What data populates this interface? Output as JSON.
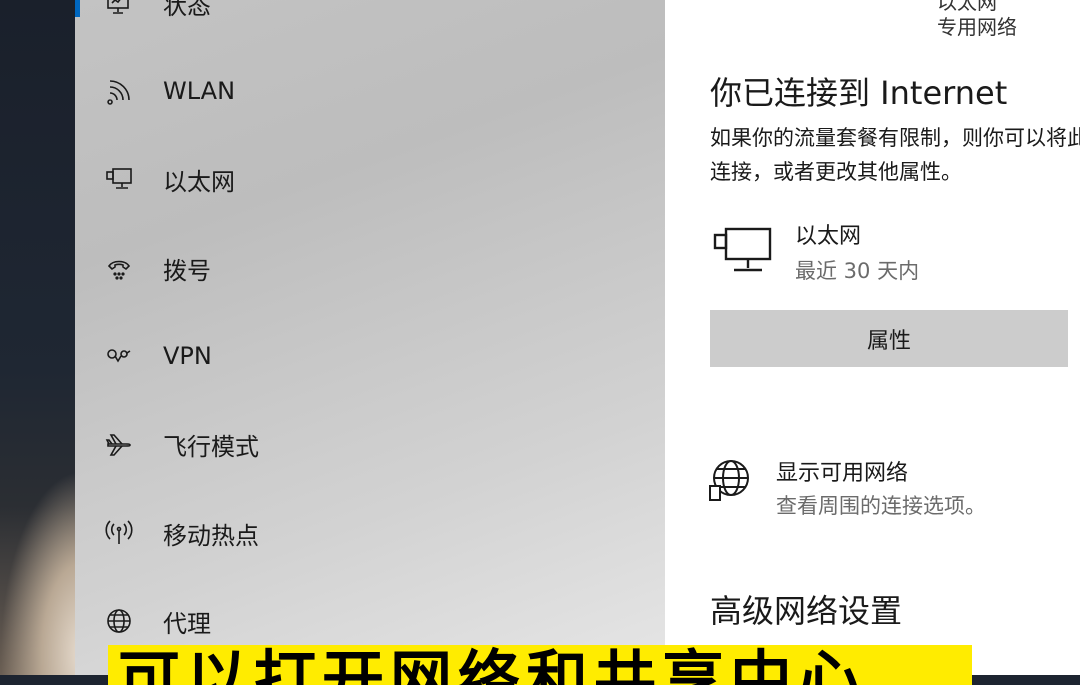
{
  "nav": {
    "items": [
      {
        "label": "状态",
        "icon": "monitor-status-icon"
      },
      {
        "label": "WLAN",
        "icon": "wifi-icon"
      },
      {
        "label": "以太网",
        "icon": "ethernet-icon"
      },
      {
        "label": "拨号",
        "icon": "dialup-icon"
      },
      {
        "label": "VPN",
        "icon": "vpn-icon"
      },
      {
        "label": "飞行模式",
        "icon": "airplane-icon"
      },
      {
        "label": "移动热点",
        "icon": "hotspot-icon"
      },
      {
        "label": "代理",
        "icon": "globe-icon"
      }
    ],
    "active_index": 0,
    "accent": "#0067c0"
  },
  "status": {
    "network_name_partial": "以太网",
    "network_type": "专用网络",
    "connected_heading": "你已连接到 Internet",
    "metered_desc_line1": "如果你的流量套餐有限制，则你可以将此网络设置为按流量计费的",
    "metered_desc_line2": "连接，或者更改其他属性。",
    "adapter": {
      "name": "以太网",
      "usage": "最近 30 天内"
    },
    "properties_button": "属性",
    "show_networks": {
      "title": "显示可用网络",
      "subtitle": "查看周围的连接选项。"
    },
    "advanced_heading": "高级网络设置"
  },
  "caption": {
    "text": "可以打开网络和共享中心",
    "background": "#ffec00"
  }
}
